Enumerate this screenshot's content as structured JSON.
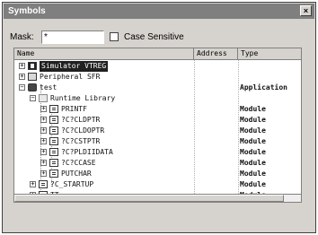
{
  "window": {
    "title": "Symbols",
    "close_glyph": "×"
  },
  "filter": {
    "mask_label": "Mask:",
    "mask_value": "*",
    "case_label": "Case Sensitive",
    "case_checked": false
  },
  "columns": [
    "Name",
    "Address",
    "Type"
  ],
  "tree": [
    {
      "label": "Simulator VTREG",
      "type": "",
      "expander": "+",
      "icon": "simulator-icon",
      "selected": true
    },
    {
      "label": "Peripheral SFR",
      "type": "",
      "expander": "+",
      "icon": "peripheral-icon"
    },
    {
      "label": "test",
      "type": "Application",
      "expander": "−",
      "icon": "application-icon"
    },
    {
      "label": "Runtime Library",
      "type": "",
      "expander": "−",
      "icon": "library-icon"
    },
    {
      "label": "PRINTF",
      "type": "Module",
      "expander": "+",
      "icon": "module-icon"
    },
    {
      "label": "?C?CLDPTR",
      "type": "Module",
      "expander": "+",
      "icon": "module-icon"
    },
    {
      "label": "?C?CLDOPTR",
      "type": "Module",
      "expander": "+",
      "icon": "module-icon"
    },
    {
      "label": "?C?CSTPTR",
      "type": "Module",
      "expander": "+",
      "icon": "module-icon"
    },
    {
      "label": "?C?PLDIIDATA",
      "type": "Module",
      "expander": "+",
      "icon": "module-icon"
    },
    {
      "label": "?C?CCASE",
      "type": "Module",
      "expander": "+",
      "icon": "module-icon"
    },
    {
      "label": "PUTCHAR",
      "type": "Module",
      "expander": "+",
      "icon": "module-icon"
    },
    {
      "label": "?C_STARTUP",
      "type": "Module",
      "expander": "+",
      "icon": "module-icon"
    },
    {
      "label": "TT",
      "type": "Module",
      "expander": "+",
      "icon": "module-icon"
    }
  ]
}
